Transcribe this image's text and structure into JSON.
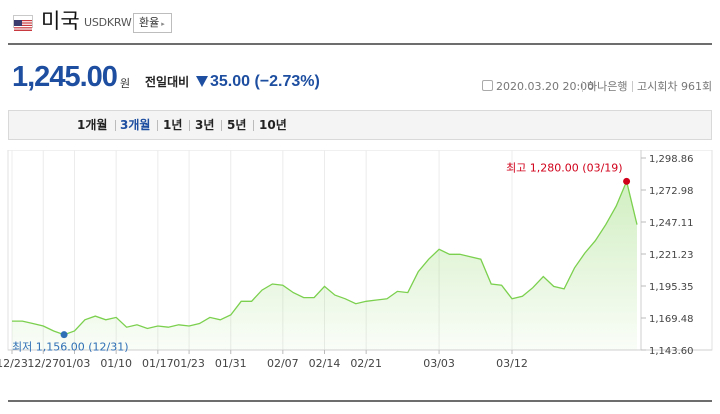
{
  "header": {
    "country": "미국",
    "code": "USDKRW",
    "exchange_button": "환율",
    "flag_icon": "us-flag-icon"
  },
  "quote": {
    "price": "1,245.00",
    "unit": "원",
    "compare_label": "전일대비",
    "change": "35.00 (−2.73%)",
    "direction": "down",
    "datetime": "2020.03.20 20:00",
    "bank": "하나은행",
    "notice": "고시회차 961회"
  },
  "periods": [
    {
      "label": "1개월",
      "active": false
    },
    {
      "label": "3개월",
      "active": true
    },
    {
      "label": "1년",
      "active": false
    },
    {
      "label": "3년",
      "active": false
    },
    {
      "label": "5년",
      "active": false
    },
    {
      "label": "10년",
      "active": false
    }
  ],
  "colors": {
    "accent": "#1d4ea0",
    "line": "#7bd04e",
    "fill": "#e3f6d3",
    "high": "#d0021b",
    "low": "#2f6fb5"
  },
  "chart_data": {
    "type": "area",
    "x_tick_labels": [
      "12/23",
      "12/27",
      "01/03",
      "01/10",
      "01/17",
      "01/23",
      "01/31",
      "02/07",
      "02/14",
      "02/21",
      "03/03",
      "03/12"
    ],
    "x_tick_index": [
      0,
      3,
      6,
      10,
      14,
      17,
      21,
      26,
      30,
      34,
      41,
      48
    ],
    "y_tick_labels": [
      "1,298.86",
      "1,272.98",
      "1,247.11",
      "1,221.23",
      "1,195.35",
      "1,169.48",
      "1,143.60"
    ],
    "y_ticks": [
      1298.86,
      1272.98,
      1247.11,
      1221.23,
      1195.35,
      1169.48,
      1143.6
    ],
    "ylim": [
      1143.6,
      1298.86
    ],
    "values": [
      1167,
      1167,
      1165,
      1163,
      1159,
      1156,
      1159,
      1168,
      1171,
      1168,
      1170,
      1162,
      1164,
      1161,
      1163,
      1162,
      1164,
      1163,
      1165,
      1170,
      1168,
      1172,
      1183,
      1183,
      1192,
      1197,
      1196,
      1190,
      1186,
      1186,
      1195,
      1188,
      1185,
      1181,
      1183,
      1184,
      1185,
      1191,
      1190,
      1207,
      1217,
      1225,
      1221,
      1221,
      1219,
      1217,
      1197,
      1196,
      1185,
      1187,
      1194,
      1203,
      1195,
      1193,
      1210,
      1222,
      1232,
      1245,
      1260,
      1280,
      1245
    ],
    "high": {
      "label": "최고 1,280.00 (03/19)",
      "index": 59,
      "value": 1280
    },
    "low": {
      "label": "최저 1,156.00 (12/31)",
      "index": 5,
      "value": 1156
    },
    "grid": "vertical"
  }
}
